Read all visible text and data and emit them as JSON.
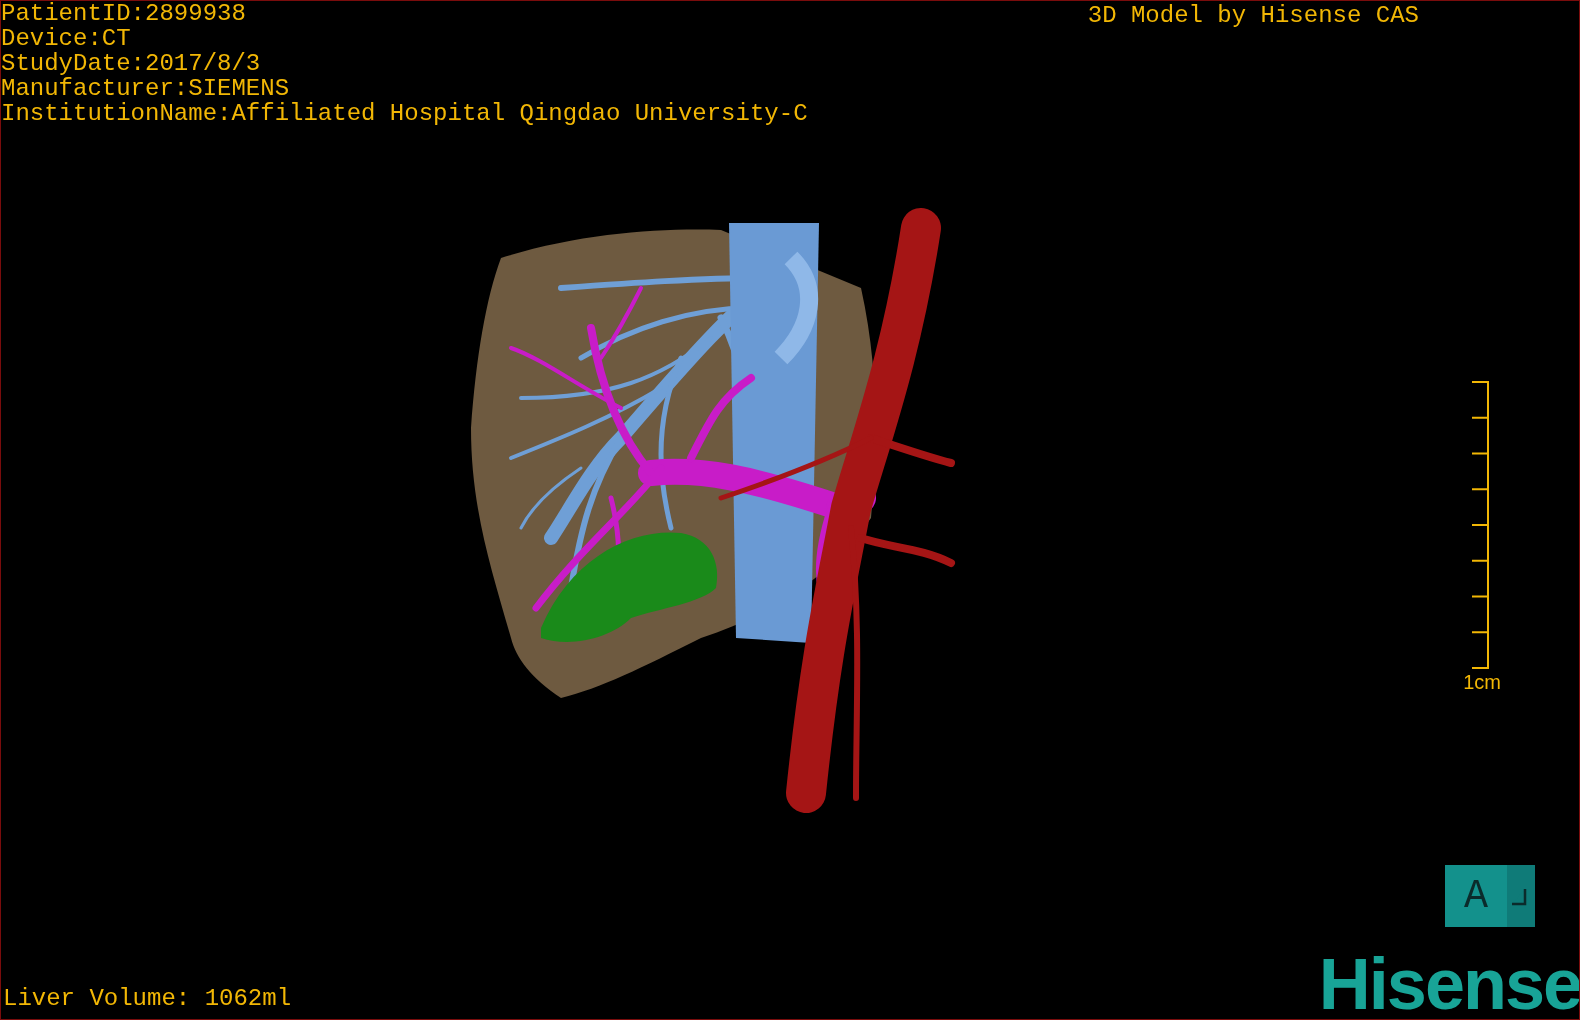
{
  "study_info": [
    "PatientID:2899938",
    "Device:CT",
    "StudyDate:2017/8/3",
    "Manufacturer:SIEMENS",
    "InstitutionName:Affiliated Hospital Qingdao University-C"
  ],
  "title": "3D Model by Hisense CAS",
  "scale": {
    "label": "1cm"
  },
  "liver_volume": "Liver Volume: 1062ml",
  "orientation_cube": {
    "front_label": "A"
  },
  "logo": "Hisense"
}
